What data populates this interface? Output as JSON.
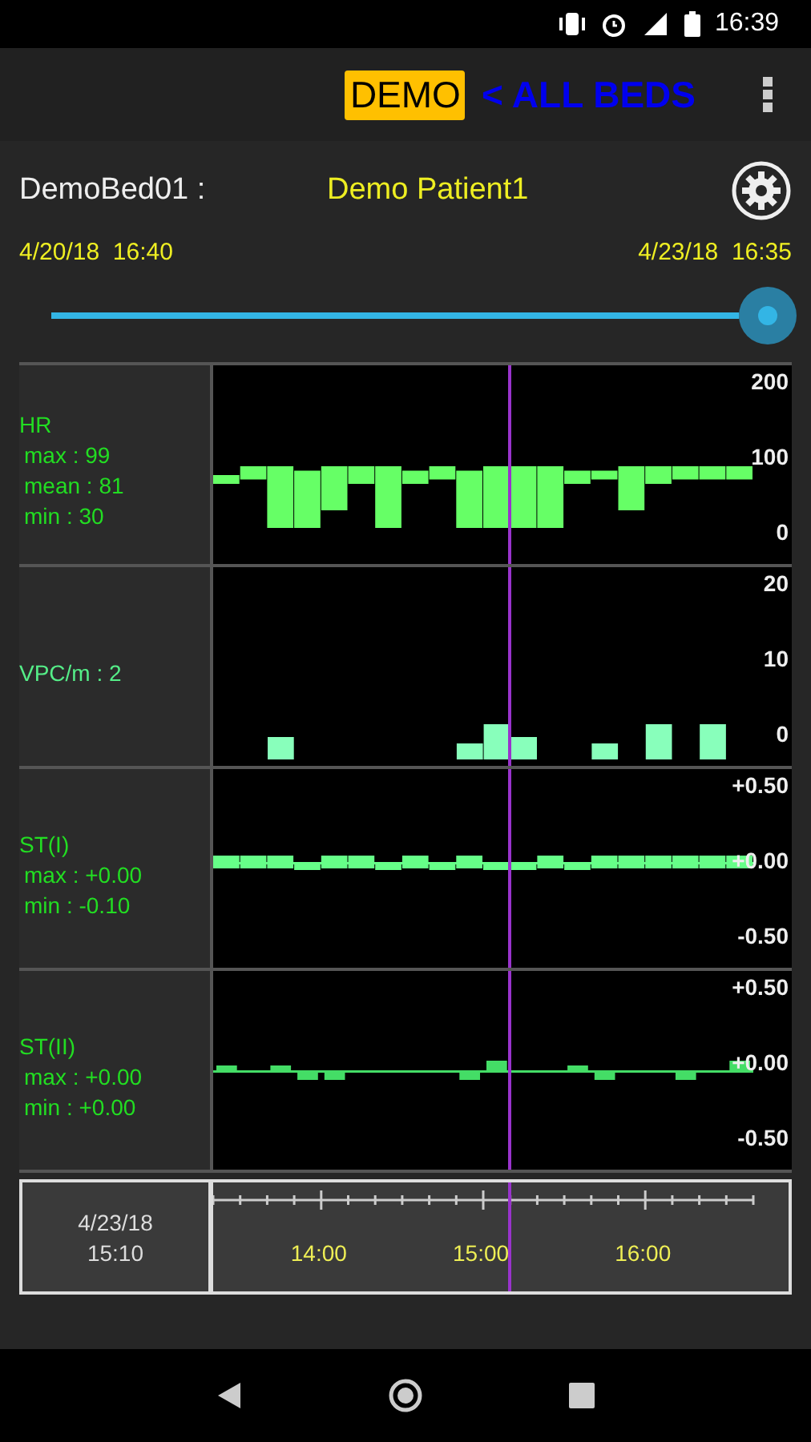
{
  "status_bar": {
    "time": "16:39"
  },
  "app_bar": {
    "demo_badge": "DEMO",
    "all_beds_link": "< ALL BEDS"
  },
  "patient": {
    "bed": "DemoBed01 :",
    "name": "Demo Patient1"
  },
  "range": {
    "start": "4/20/18  16:40",
    "end": "4/23/18  16:35",
    "level": 0.99
  },
  "charts": [
    {
      "label": "HR",
      "kind": "range",
      "stats": [
        "max : 99",
        "mean : 81",
        "min : 30"
      ],
      "y_ticks": [
        "200",
        "100",
        "0"
      ]
    },
    {
      "label": "VPC/m : 2",
      "kind": "bars",
      "y_ticks": [
        "20",
        "10",
        "0"
      ]
    },
    {
      "label": "ST(I)",
      "kind": "band",
      "stats": [
        "max : +0.00",
        "min : -0.10"
      ],
      "y_ticks": [
        "+0.50",
        "+0.00",
        "-0.50"
      ]
    },
    {
      "label": "ST(II)",
      "kind": "line",
      "stats": [
        "max : +0.00",
        "min : +0.00"
      ],
      "y_ticks": [
        "+0.50",
        "+0.00",
        "-0.50"
      ]
    }
  ],
  "timeline": {
    "date": "4/23/18",
    "time": "15:10",
    "labels": [
      "14:00",
      "15:00",
      "16:00"
    ],
    "level": 0.55
  }
}
